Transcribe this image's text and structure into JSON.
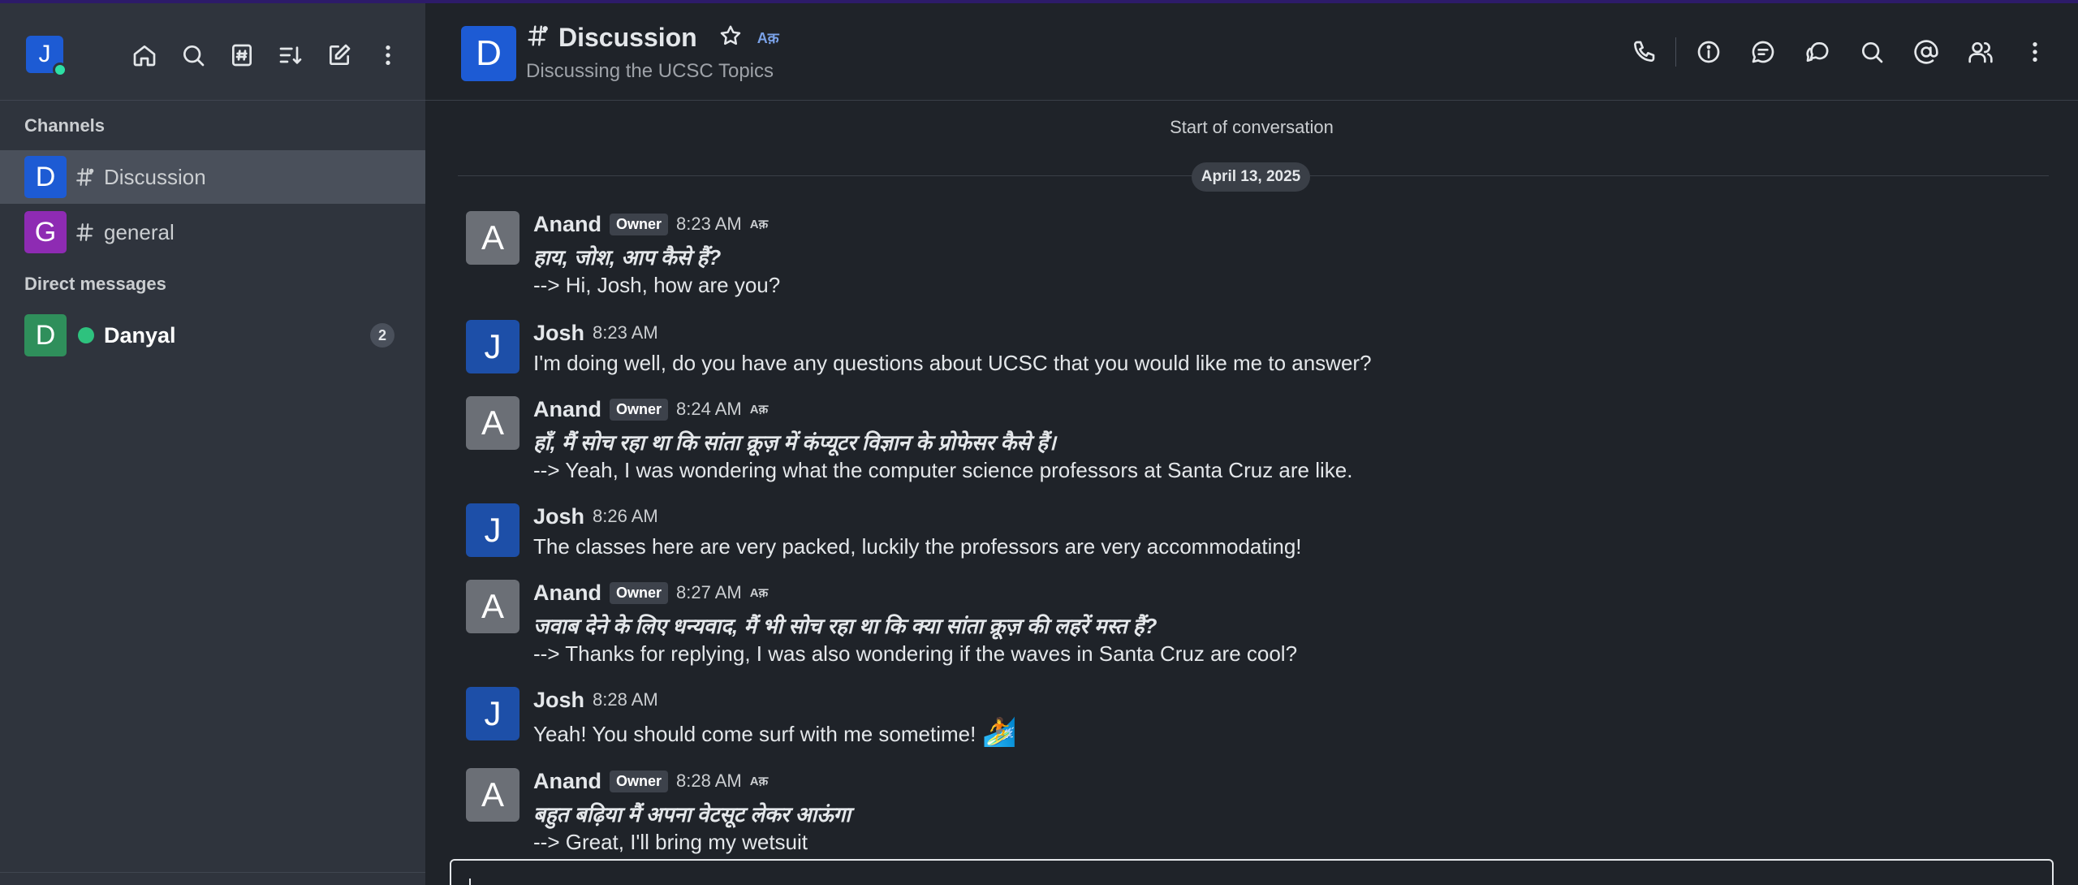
{
  "sidebar": {
    "user_initial": "J",
    "sections": {
      "channels": "Channels",
      "direct_messages": "Direct messages"
    },
    "channels": [
      {
        "initial": "D",
        "name": "Discussion",
        "color": "#1d5bd4",
        "active": true,
        "icon": "discussion-hash-icon"
      },
      {
        "initial": "G",
        "name": "general",
        "color": "#8e2bb3",
        "active": false,
        "icon": "hash-icon"
      }
    ],
    "dms": [
      {
        "initial": "D",
        "name": "Danyal",
        "color": "#2f8f5b",
        "status": "online",
        "unread": "2"
      }
    ]
  },
  "header": {
    "initial": "D",
    "title": "Discussion",
    "topic": "Discussing the UCSC Topics",
    "translate_glyph": "Aक़"
  },
  "conversation": {
    "start_text": "Start of conversation",
    "date": "April 13, 2025"
  },
  "messages": [
    {
      "initial": "A",
      "author": "Anand",
      "role": "Owner",
      "time": "8:23 AM",
      "translated": true,
      "lines": [
        "हाय, जोश, आप कैसे हैं?",
        "--> Hi, Josh, how are you?"
      ]
    },
    {
      "initial": "J",
      "author": "Josh",
      "role": "",
      "time": "8:23 AM",
      "translated": false,
      "lines": [
        "I'm doing well, do you have any questions about UCSC that you would like me to answer?"
      ]
    },
    {
      "initial": "A",
      "author": "Anand",
      "role": "Owner",
      "time": "8:24 AM",
      "translated": true,
      "lines": [
        "हाँ, मैं सोच रहा था कि सांता क्रूज़ में कंप्यूटर विज्ञान के प्रोफेसर कैसे हैं।",
        "--> Yeah, I was wondering what the computer science professors at Santa Cruz are like."
      ]
    },
    {
      "initial": "J",
      "author": "Josh",
      "role": "",
      "time": "8:26 AM",
      "translated": false,
      "lines": [
        "The classes here are very packed, luckily the professors are very accommodating!"
      ]
    },
    {
      "initial": "A",
      "author": "Anand",
      "role": "Owner",
      "time": "8:27 AM",
      "translated": true,
      "lines": [
        "जवाब देने के लिए धन्यवाद, मैं भी सोच रहा था कि क्या सांता क्रूज़ की लहरें मस्त हैं?",
        "--> Thanks for replying, I was also wondering if the waves in Santa Cruz are cool?"
      ]
    },
    {
      "initial": "J",
      "author": "Josh",
      "role": "",
      "time": "8:28 AM",
      "translated": false,
      "lines": [
        "Yeah! You should come surf with me sometime!"
      ],
      "emoji": "🏄"
    },
    {
      "initial": "A",
      "author": "Anand",
      "role": "Owner",
      "time": "8:28 AM",
      "translated": true,
      "lines": [
        "बहुत बढ़िया मैं अपना वेटसूट लेकर आऊंगा",
        "--> Great, I'll bring my wetsuit"
      ]
    }
  ],
  "colors": {
    "avatar_anand": "#6b6f76",
    "avatar_josh": "#1d4fa8"
  }
}
